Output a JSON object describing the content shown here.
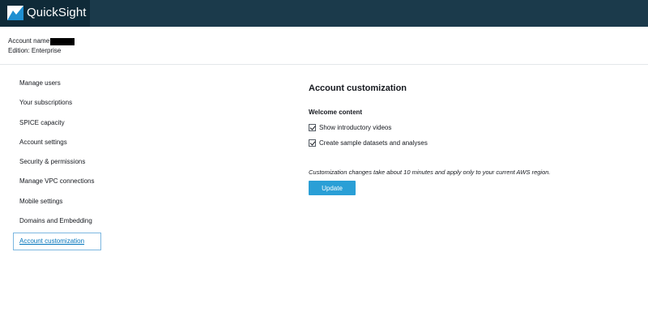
{
  "app": {
    "logo_text": "QuickSight"
  },
  "account": {
    "name_label": "Account name",
    "edition_label": "Edition: Enterprise"
  },
  "sidebar": {
    "items": [
      {
        "label": "Manage users",
        "active": false
      },
      {
        "label": "Your subscriptions",
        "active": false
      },
      {
        "label": "SPICE capacity",
        "active": false
      },
      {
        "label": "Account settings",
        "active": false
      },
      {
        "label": "Security & permissions",
        "active": false
      },
      {
        "label": "Manage VPC connections",
        "active": false
      },
      {
        "label": "Mobile settings",
        "active": false
      },
      {
        "label": "Domains and Embedding",
        "active": false
      },
      {
        "label": "Account customization",
        "active": true
      }
    ]
  },
  "main": {
    "title": "Account customization",
    "section_label": "Welcome content",
    "options": [
      {
        "label": "Show introductory videos",
        "checked": true
      },
      {
        "label": "Create sample datasets and analyses",
        "checked": true
      }
    ],
    "note": "Customization changes take about 10 minutes and apply only to your current AWS region.",
    "update_label": "Update"
  },
  "colors": {
    "topbar": "#1b3a4b",
    "logo_block": "#0f2a38",
    "accent": "#2a9fd6",
    "active_link": "#0073bb"
  }
}
